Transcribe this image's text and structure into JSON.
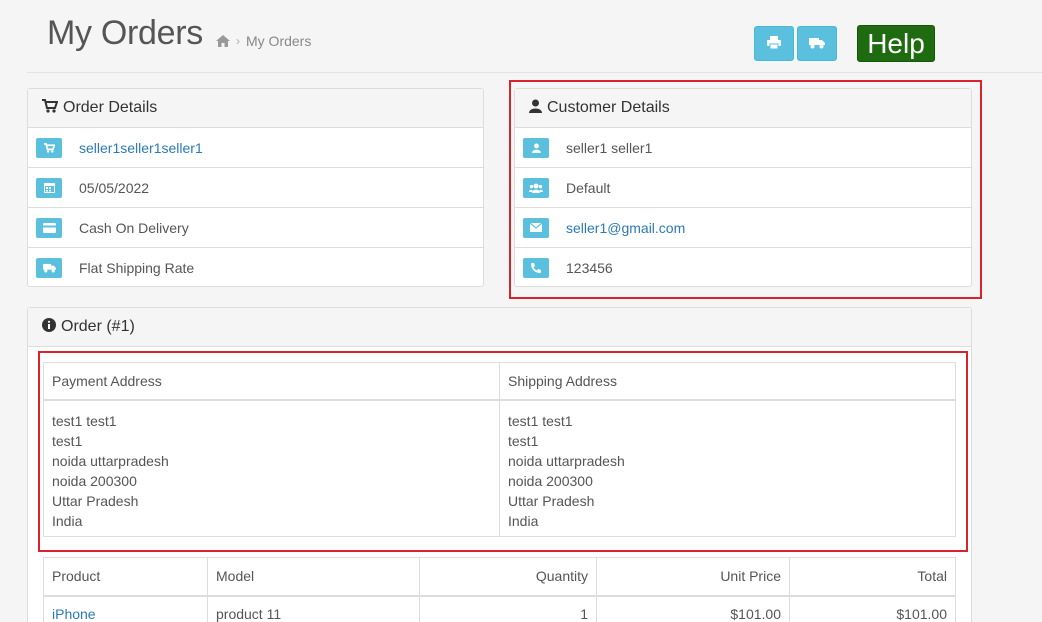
{
  "header": {
    "title": "My Orders",
    "breadcrumb_current": "My Orders",
    "help_label": "Help"
  },
  "icons": {
    "home": "home-icon",
    "print": "print-icon",
    "truck": "truck-icon",
    "cart": "shopping-cart-icon",
    "calendar": "calendar-icon",
    "card": "credit-card-icon",
    "user": "user-icon",
    "group": "group-icon",
    "mail": "envelope-icon",
    "phone": "phone-icon",
    "info": "info-circle-icon"
  },
  "colors": {
    "accent": "#5bc0de",
    "help": "#1e6b10",
    "highlight": "#d9232c",
    "link": "#2a7ab8"
  },
  "order_details": {
    "title": "Order Details",
    "store": "seller1seller1seller1",
    "date": "05/05/2022",
    "payment_method": "Cash On Delivery",
    "shipping_method": "Flat Shipping Rate"
  },
  "customer_details": {
    "title": "Customer Details",
    "name": "seller1 seller1",
    "group": "Default",
    "email": "seller1@gmail.com",
    "telephone": "123456"
  },
  "order": {
    "title": "Order (#1)",
    "payment_address_label": "Payment Address",
    "shipping_address_label": "Shipping Address",
    "payment_address": [
      "test1 test1",
      "test1",
      "noida uttarpradesh",
      "noida 200300",
      "Uttar Pradesh",
      "India"
    ],
    "shipping_address": [
      "test1 test1",
      "test1",
      "noida uttarpradesh",
      "noida 200300",
      "Uttar Pradesh",
      "India"
    ],
    "products_columns": [
      "Product",
      "Model",
      "Quantity",
      "Unit Price",
      "Total"
    ],
    "products": [
      {
        "product": "iPhone",
        "model": "product 11",
        "quantity": "1",
        "unit_price": "$101.00",
        "total": "$101.00"
      }
    ]
  }
}
